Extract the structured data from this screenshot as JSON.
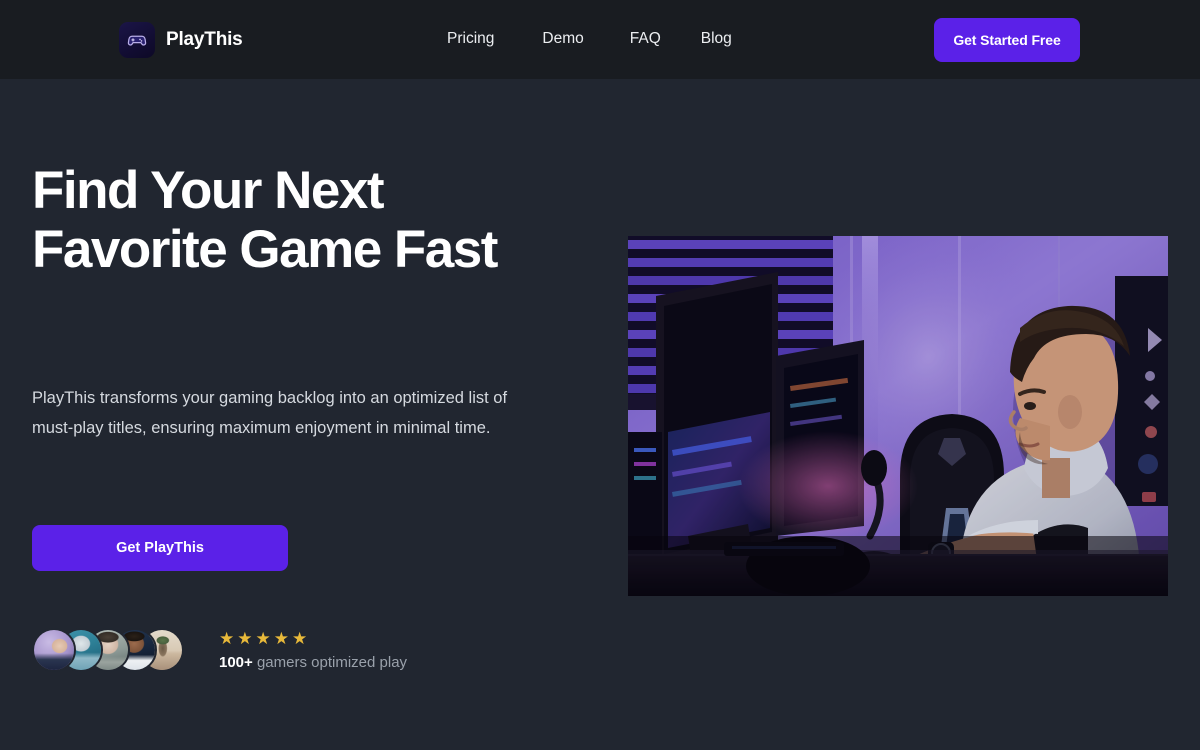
{
  "brand": {
    "name": "PlayThis",
    "logo_icon": "gamepad-icon",
    "accent_color": "#5b21e8",
    "page_bg": "#212630",
    "header_bg": "#191c21"
  },
  "header": {
    "nav": [
      {
        "label": "Pricing"
      },
      {
        "label": "Demo"
      },
      {
        "label": "FAQ"
      },
      {
        "label": "Blog"
      }
    ],
    "cta_label": "Get Started Free"
  },
  "hero": {
    "headline": "Find Your Next Favorite Game Fast",
    "subheadline": "PlayThis transforms your gaming backlog into an optimized list of must-play titles, ensuring maximum enjoyment in minimal time.",
    "cta_label": "Get PlayThis",
    "image_alt": "Gamer in gray hoodie at desk with monitors and purple ambient lighting"
  },
  "social_proof": {
    "rating_stars": 5,
    "star_glyph": "★",
    "star_color": "#e8b93a",
    "count_label": "100+",
    "count_suffix": "gamers optimized play",
    "avatars": [
      {
        "name": "avatar-1",
        "bg": "#b9a8d8",
        "skin": "#2a3550"
      },
      {
        "name": "avatar-2",
        "bg": "#2d7f96",
        "skin": "#cfd8dd"
      },
      {
        "name": "avatar-3",
        "bg": "#8d9a96",
        "skin": "#d9c9bd"
      },
      {
        "name": "avatar-4",
        "bg": "#16243a",
        "skin": "#8a5f45"
      },
      {
        "name": "avatar-5",
        "bg": "#d8c9b4",
        "skin": "#b9a894"
      }
    ]
  }
}
